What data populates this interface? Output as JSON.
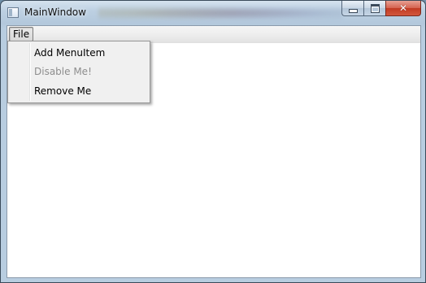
{
  "window": {
    "title": "MainWindow",
    "icon": "app-window-icon",
    "caption_buttons": {
      "minimize_icon": "minimize-icon",
      "maximize_icon": "maximize-icon",
      "close_icon": "close-icon"
    }
  },
  "menubar": {
    "items": [
      {
        "label": "File",
        "open": true
      }
    ]
  },
  "file_menu": {
    "items": [
      {
        "label": "Add MenuItem",
        "enabled": true
      },
      {
        "label": "Disable Me!",
        "enabled": false
      },
      {
        "label": "Remove Me",
        "enabled": true
      }
    ]
  },
  "colors": {
    "disabled_text": "#8d8d8d",
    "close_button": "#c13a22",
    "menu_background": "#f0f0f0"
  }
}
